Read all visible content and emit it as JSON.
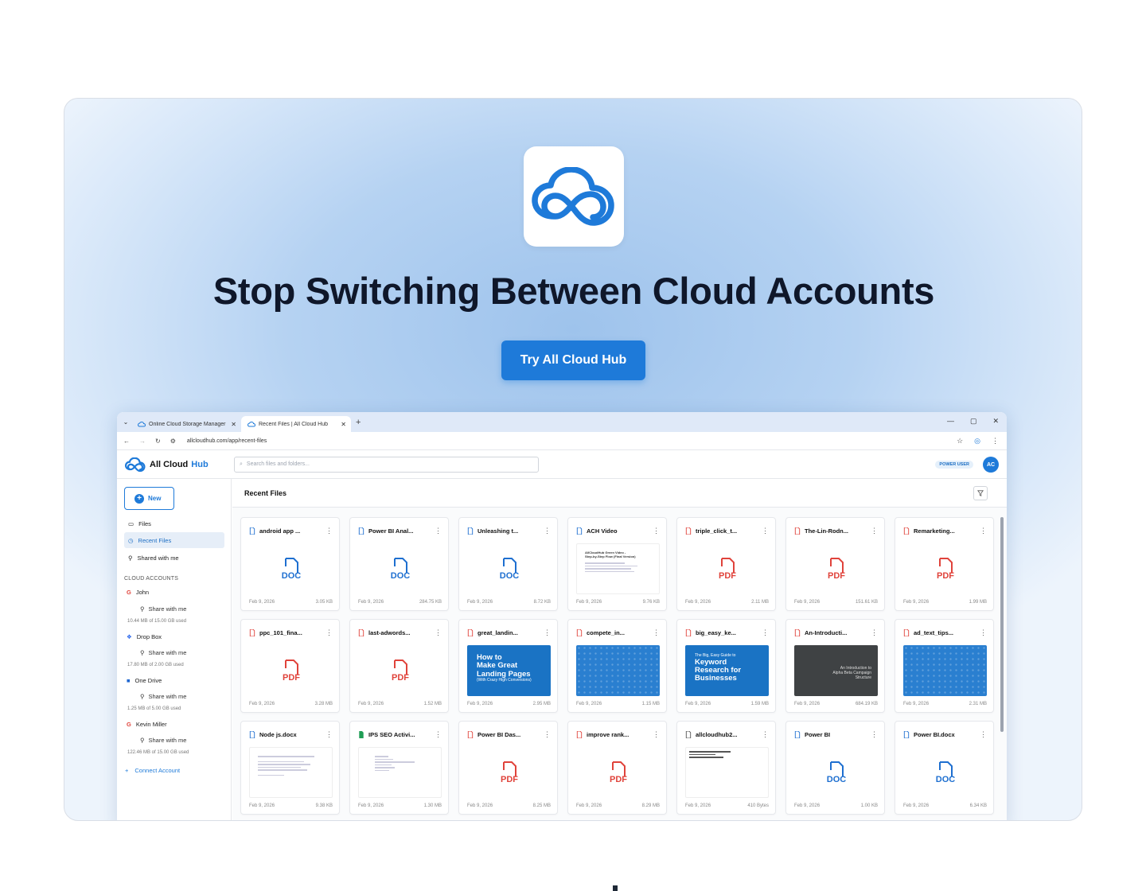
{
  "hero": {
    "headline": "Stop Switching Between Cloud Accounts",
    "cta_label": "Try All Cloud Hub",
    "brand_color": "#1e7ad9"
  },
  "browser": {
    "tabs": [
      {
        "title": "Online Cloud Storage Manager",
        "active": false
      },
      {
        "title": "Recent Files | All Cloud Hub",
        "active": true
      }
    ],
    "url": "allcloudhub.com/app/recent-files"
  },
  "app": {
    "brand_name": "All Cloud",
    "brand_accent": "Hub",
    "search_placeholder": "Search files and folders...",
    "badge": "POWER USER",
    "avatar_initials": "AC",
    "new_label": "New",
    "nav": [
      {
        "label": "Files",
        "icon": "folder-icon"
      },
      {
        "label": "Recent Files",
        "icon": "clock-icon",
        "active": true
      },
      {
        "label": "Shared with me",
        "icon": "user-share-icon"
      }
    ],
    "accounts_heading": "CLOUD ACCOUNTS",
    "accounts": [
      {
        "name": "John",
        "icon": "google-drive-icon",
        "share": "Share with me",
        "used": "10.44 MB of 15.00 GB used"
      },
      {
        "name": "Drop Box",
        "icon": "dropbox-icon",
        "share": "Share with me",
        "used": "17.80 MB of 2.00 GB used"
      },
      {
        "name": "One Drive",
        "icon": "onedrive-icon",
        "share": "Share with me",
        "used": "1.25 MB of 5.00 GB used"
      },
      {
        "name": "Kevin Miller",
        "icon": "google-drive-icon",
        "share": "Share with me",
        "used": "122.46 MB of 15.00 GB used"
      }
    ],
    "connect_label": "Connect Account",
    "main_title": "Recent Files"
  },
  "files": [
    {
      "name": "android app ...",
      "type": "doc",
      "date": "Feb 9, 2026",
      "size": "3.05 KB",
      "preview": "doc-icon"
    },
    {
      "name": "Power BI Anal...",
      "type": "doc",
      "date": "Feb 9, 2026",
      "size": "284.75 KB",
      "preview": "doc-icon"
    },
    {
      "name": "Unleashing t...",
      "type": "doc",
      "date": "Feb 9, 2026",
      "size": "8.72 KB",
      "preview": "doc-icon"
    },
    {
      "name": "ACH Video",
      "type": "doc",
      "date": "Feb 9, 2026",
      "size": "9.76 KB",
      "preview": "doc-page"
    },
    {
      "name": "triple_click_t...",
      "type": "pdf",
      "date": "Feb 9, 2026",
      "size": "2.11 MB",
      "preview": "pdf-icon"
    },
    {
      "name": "The-Lin-Rodn...",
      "type": "pdf",
      "date": "Feb 9, 2026",
      "size": "151.61 KB",
      "preview": "pdf-icon"
    },
    {
      "name": "Remarketing...",
      "type": "pdf",
      "date": "Feb 9, 2026",
      "size": "1.99 MB",
      "preview": "pdf-icon"
    },
    {
      "name": "ppc_101_fina...",
      "type": "pdf",
      "date": "Feb 9, 2026",
      "size": "3.28 MB",
      "preview": "pdf-icon"
    },
    {
      "name": "last-adwords...",
      "type": "pdf",
      "date": "Feb 9, 2026",
      "size": "1.52 MB",
      "preview": "pdf-icon"
    },
    {
      "name": "great_landin...",
      "type": "pdf",
      "date": "Feb 9, 2026",
      "size": "2.95 MB",
      "preview": "blue-landing"
    },
    {
      "name": "compete_in...",
      "type": "pdf",
      "date": "Feb 9, 2026",
      "size": "1.15 MB",
      "preview": "pattern"
    },
    {
      "name": "big_easy_ke...",
      "type": "pdf",
      "date": "Feb 9, 2026",
      "size": "1.59 MB",
      "preview": "blue-keyword"
    },
    {
      "name": "An-Introducti...",
      "type": "pdf",
      "date": "Feb 9, 2026",
      "size": "684.19 KB",
      "preview": "dark"
    },
    {
      "name": "ad_text_tips...",
      "type": "pdf",
      "date": "Feb 9, 2026",
      "size": "2.31 MB",
      "preview": "pattern"
    },
    {
      "name": "Node js.docx",
      "type": "doc",
      "date": "Feb 9, 2026",
      "size": "9.38 KB",
      "preview": "doc-page"
    },
    {
      "name": "IPS SEO Activi...",
      "type": "sheet",
      "date": "Feb 9, 2026",
      "size": "1.30 MB",
      "preview": "sheet-page"
    },
    {
      "name": "Power BI Das...",
      "type": "pdf",
      "date": "Feb 9, 2026",
      "size": "8.25 MB",
      "preview": "pdf-icon"
    },
    {
      "name": "improve rank...",
      "type": "pdf",
      "date": "Feb 9, 2026",
      "size": "8.29 MB",
      "preview": "pdf-icon"
    },
    {
      "name": "allcloudhub2...",
      "type": "txt",
      "date": "Feb 9, 2026",
      "size": "410 Bytes",
      "preview": "text-page"
    },
    {
      "name": "Power BI",
      "type": "doc",
      "date": "Feb 9, 2026",
      "size": "1.00 KB",
      "preview": "doc-icon"
    },
    {
      "name": "Power BI.docx",
      "type": "doc",
      "date": "Feb 9, 2026",
      "size": "6.34 KB",
      "preview": "doc-icon"
    }
  ],
  "previews": {
    "landing": {
      "l1": "How to",
      "l2": "Make Great",
      "l3": "Landing Pages",
      "sub": "(With Crazy High Conversions)"
    },
    "keyword": {
      "sub": "The Big, Easy Guide to",
      "l1": "Keyword",
      "l2": "Research for",
      "l3": "Businesses"
    },
    "dark": {
      "l1": "An Introduction to",
      "l2": "Alpha Beta Campaign",
      "l3": "Structure"
    },
    "ach": {
      "l1": "AllCloudHub Green Video -",
      "l2": "Step-by-Step Flow (Final Version)"
    }
  }
}
